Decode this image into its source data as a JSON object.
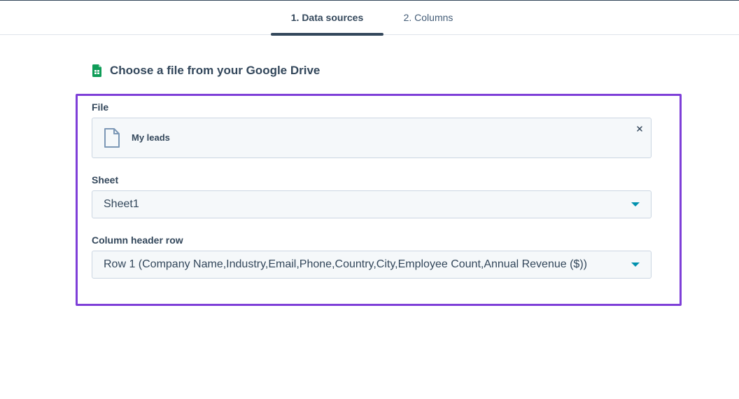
{
  "tabs": [
    {
      "label": "1. Data sources",
      "active": true
    },
    {
      "label": "2. Columns",
      "active": false
    }
  ],
  "heading": {
    "icon": "google-sheets-icon",
    "text": "Choose a file from your Google Drive"
  },
  "file_field": {
    "label": "File",
    "file_name": "My leads",
    "icon": "document-icon",
    "close_icon": "close-icon"
  },
  "sheet_field": {
    "label": "Sheet",
    "selected": "Sheet1"
  },
  "header_row_field": {
    "label": "Column header row",
    "selected": "Row 1 (Company Name,Industry,Email,Phone,Country,City,Employee Count,Annual Revenue ($))"
  },
  "colors": {
    "text": "#33475b",
    "highlight_border": "#7e3fd8",
    "caret": "#0091ae",
    "field_bg": "#f5f8fa",
    "field_border": "#cbd6e2",
    "sheets_green": "#0f9d58"
  }
}
